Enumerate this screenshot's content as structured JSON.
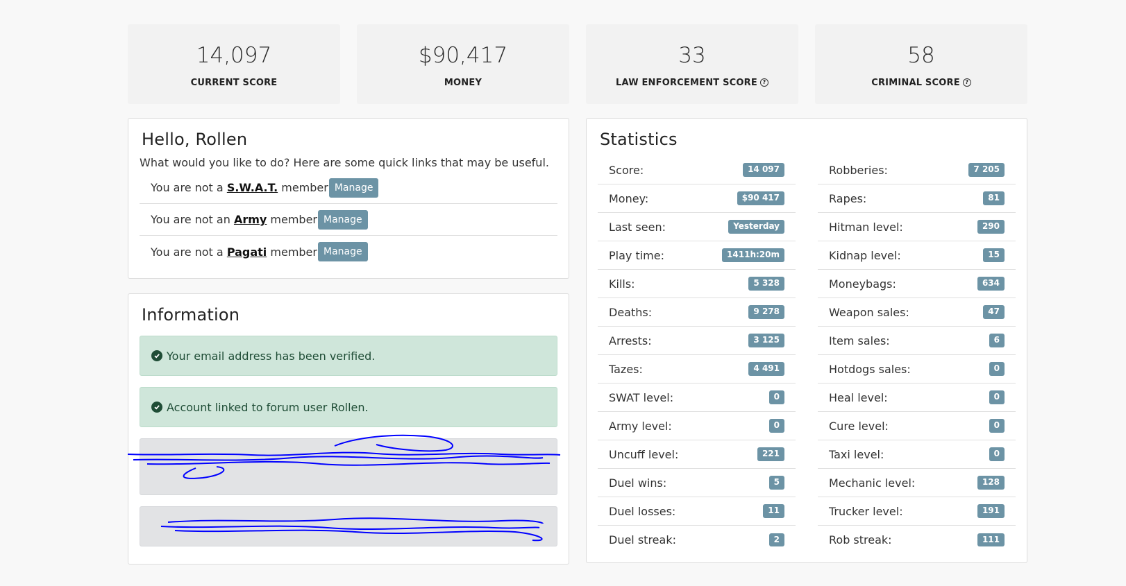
{
  "cards": [
    {
      "value": "14,097",
      "label": "CURRENT SCORE",
      "help": false
    },
    {
      "value": "$90,417",
      "label": "MONEY",
      "help": false
    },
    {
      "value": "33",
      "label": "LAW ENFORCEMENT SCORE",
      "help": true
    },
    {
      "value": "58",
      "label": "CRIMINAL SCORE",
      "help": true
    }
  ],
  "hello": {
    "title": "Hello, Rollen",
    "subtitle": "What would you like to do? Here are some quick links that may be useful.",
    "members": [
      {
        "prefix": "You are not a ",
        "org": "S.W.A.T.",
        "suffix": " member",
        "button": "Manage"
      },
      {
        "prefix": "You are not an ",
        "org": "Army",
        "suffix": " member",
        "button": "Manage"
      },
      {
        "prefix": "You are not a ",
        "org": "Pagati",
        "suffix": " member",
        "button": "Manage"
      }
    ]
  },
  "information": {
    "title": "Information",
    "alerts": [
      {
        "text": "Your email address has been verified."
      },
      {
        "text": "Account linked to forum user Rollen."
      }
    ]
  },
  "statistics": {
    "title": "Statistics",
    "left": [
      {
        "label": "Score:",
        "value": "14 097"
      },
      {
        "label": "Money:",
        "value": "$90 417"
      },
      {
        "label": "Last seen:",
        "value": "Yesterday"
      },
      {
        "label": "Play time:",
        "value": "1411h:20m"
      },
      {
        "label": "Kills:",
        "value": "5 328"
      },
      {
        "label": "Deaths:",
        "value": "9 278"
      },
      {
        "label": "Arrests:",
        "value": "3 125"
      },
      {
        "label": "Tazes:",
        "value": "4 491"
      },
      {
        "label": "SWAT level:",
        "value": "0"
      },
      {
        "label": "Army level:",
        "value": "0"
      },
      {
        "label": "Uncuff level:",
        "value": "221"
      },
      {
        "label": "Duel wins:",
        "value": "5"
      },
      {
        "label": "Duel losses:",
        "value": "11"
      },
      {
        "label": "Duel streak:",
        "value": "2"
      }
    ],
    "right": [
      {
        "label": "Robberies:",
        "value": "7 205"
      },
      {
        "label": "Rapes:",
        "value": "81"
      },
      {
        "label": "Hitman level:",
        "value": "290"
      },
      {
        "label": "Kidnap level:",
        "value": "15"
      },
      {
        "label": "Moneybags:",
        "value": "634"
      },
      {
        "label": "Weapon sales:",
        "value": "47"
      },
      {
        "label": "Item sales:",
        "value": "6"
      },
      {
        "label": "Hotdogs sales:",
        "value": "0"
      },
      {
        "label": "Heal level:",
        "value": "0"
      },
      {
        "label": "Cure level:",
        "value": "0"
      },
      {
        "label": "Taxi level:",
        "value": "0"
      },
      {
        "label": "Mechanic level:",
        "value": "128"
      },
      {
        "label": "Trucker level:",
        "value": "191"
      },
      {
        "label": "Rob streak:",
        "value": "111"
      }
    ]
  },
  "colors": {
    "badge": "#6c93a5",
    "success_bg": "#cfe6da",
    "scribble": "#0000ff"
  }
}
